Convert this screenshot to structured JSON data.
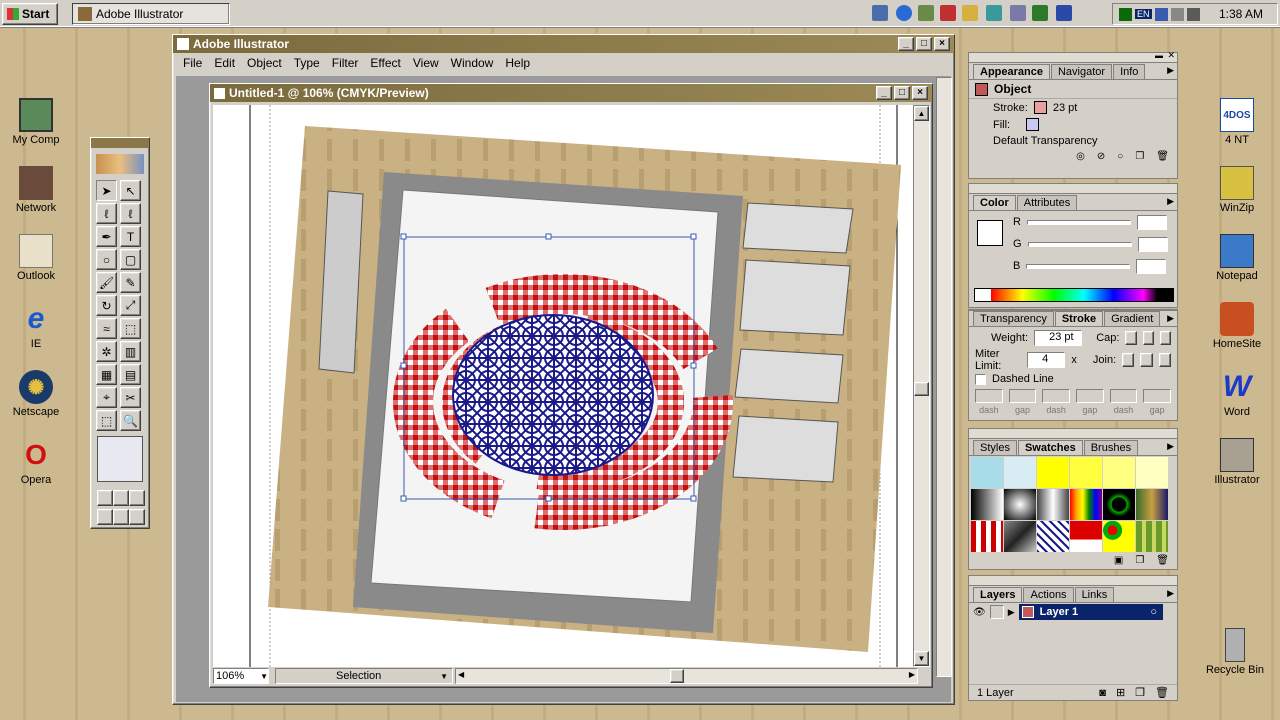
{
  "taskbar": {
    "start": "Start",
    "task": "Adobe Illustrator",
    "clock": "1:38 AM",
    "lang": "EN"
  },
  "desktop": {
    "icons": [
      "My Comp",
      "Network",
      "Outlook",
      "IE",
      "Netscape",
      "Opera",
      "4 NT",
      "WinZip",
      "Notepad",
      "HomeSite",
      "Word",
      "Illustrator",
      "Recycle Bin"
    ],
    "badge": "4DOS"
  },
  "app": {
    "title": "Adobe Illustrator",
    "menu": [
      "File",
      "Edit",
      "Object",
      "Type",
      "Filter",
      "Effect",
      "View",
      "Window",
      "Help"
    ]
  },
  "doc": {
    "title": "Untitled-1 @ 106% (CMYK/Preview)",
    "zoom": "106%",
    "status": "Selection"
  },
  "appearance": {
    "tabs": [
      "Appearance",
      "Navigator",
      "Info"
    ],
    "header": "Object",
    "stroke_label": "Stroke:",
    "stroke_value": "23 pt",
    "fill_label": "Fill:",
    "transparency": "Default Transparency"
  },
  "color": {
    "tabs": [
      "Color",
      "Attributes"
    ],
    "r": "R",
    "g": "G",
    "b": "B"
  },
  "stroke": {
    "tabs": [
      "Transparency",
      "Stroke",
      "Gradient"
    ],
    "weight_label": "Weight:",
    "weight": "23 pt",
    "cap_label": "Cap:",
    "miter_label": "Miter Limit:",
    "miter": "4",
    "miter_unit": "x",
    "join_label": "Join:",
    "dashed": "Dashed Line",
    "dash_labels": [
      "dash",
      "gap",
      "dash",
      "gap",
      "dash",
      "gap"
    ]
  },
  "swatches": {
    "tabs": [
      "Styles",
      "Swatches",
      "Brushes"
    ]
  },
  "layers": {
    "tabs": [
      "Layers",
      "Actions",
      "Links"
    ],
    "layer_name": "Layer 1",
    "count": "1 Layer"
  },
  "colors": {
    "title": "#8a7848",
    "accent": "#0a246a"
  }
}
